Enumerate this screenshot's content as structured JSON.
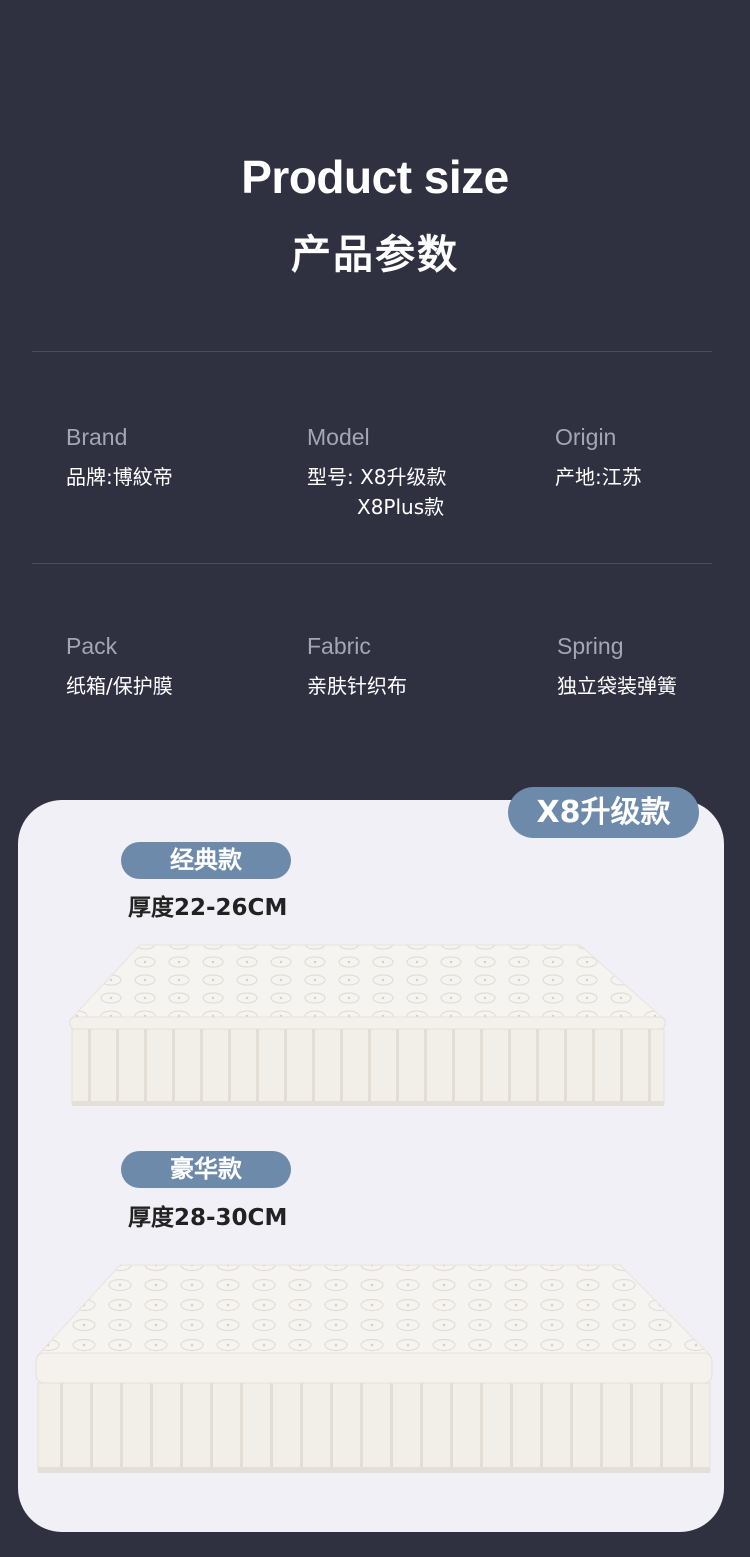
{
  "header": {
    "title_en": "Product size",
    "title_cn": "产品参数"
  },
  "specs": {
    "brand": {
      "label": "Brand",
      "value": "品牌:博紋帝"
    },
    "model": {
      "label": "Model",
      "value_line1": "型号: X8升级款",
      "value_line2": "X8Plus款"
    },
    "origin": {
      "label": "Origin",
      "value": "产地:江苏"
    },
    "pack": {
      "label": "Pack",
      "value": "纸箱/保护膜"
    },
    "fabric": {
      "label": "Fabric",
      "value": "亲肤针织布"
    },
    "spring": {
      "label": "Spring",
      "value": "独立袋装弹簧"
    }
  },
  "card": {
    "model_badge": "X8升级款",
    "variants": [
      {
        "name": "经典款",
        "thickness": "厚度22-26CM"
      },
      {
        "name": "豪华款",
        "thickness": "厚度28-30CM"
      }
    ]
  },
  "colors": {
    "background": "#2f3141",
    "card": "#f1f0f7",
    "accent_pill": "#6d8aaa",
    "label_gray": "#a3a6b3"
  }
}
